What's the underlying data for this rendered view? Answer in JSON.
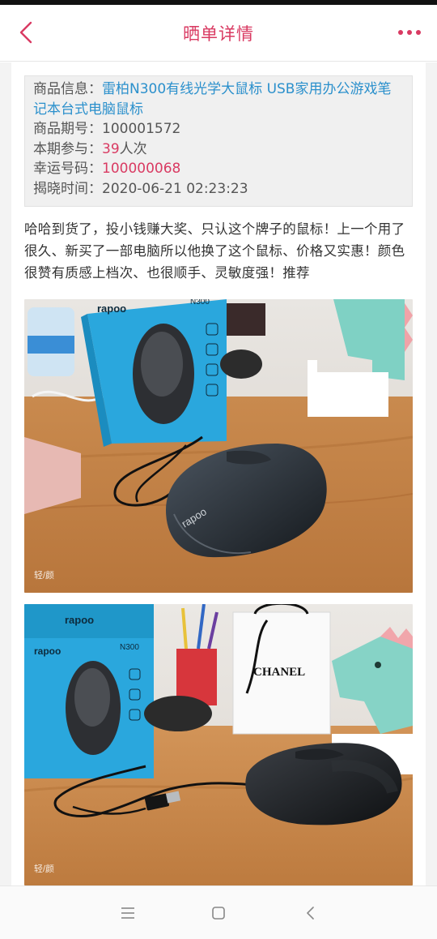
{
  "header": {
    "title": "晒单详情",
    "accent_color": "#d93a62",
    "back_icon": "chevron-left-icon",
    "more_icon": "more-dots-icon"
  },
  "product_info": {
    "name_label": "商品信息：",
    "name_value": "雷柏N300有线光学大鼠标 USB家用办公游戏笔记本台式电脑鼠标",
    "period_label": "商品期号：",
    "period_value": "100001572",
    "participation_label": "本期参与：",
    "participation_count": "39",
    "participation_unit": "人次",
    "lucky_label": "幸运号码：",
    "lucky_value": "100000068",
    "reveal_label": "揭晓时间：",
    "reveal_value": "2020-06-21 02:23:23"
  },
  "review": {
    "text": "哈哈到货了，投小钱赚大奖、只认这个牌子的鼠标！上一个用了很久、新买了一部电脑所以他换了这个鼠标、价格又实惠！颜色很赞有质感上档次、也很顺手、灵敏度强！推荐"
  },
  "photos": {
    "photo1": {
      "brand": "rapoo",
      "model": "N300",
      "mouse_logo": "rapoo",
      "watermark": "轻/颜"
    },
    "photo2": {
      "brand_top": "rapoo",
      "brand": "rapoo",
      "model": "N300",
      "bag_text": "CHANEL",
      "watermark": "轻/颜"
    }
  },
  "system_nav": {
    "menu_icon": "menu-icon",
    "home_icon": "home-square-icon",
    "back_icon": "back-chevron-icon"
  }
}
